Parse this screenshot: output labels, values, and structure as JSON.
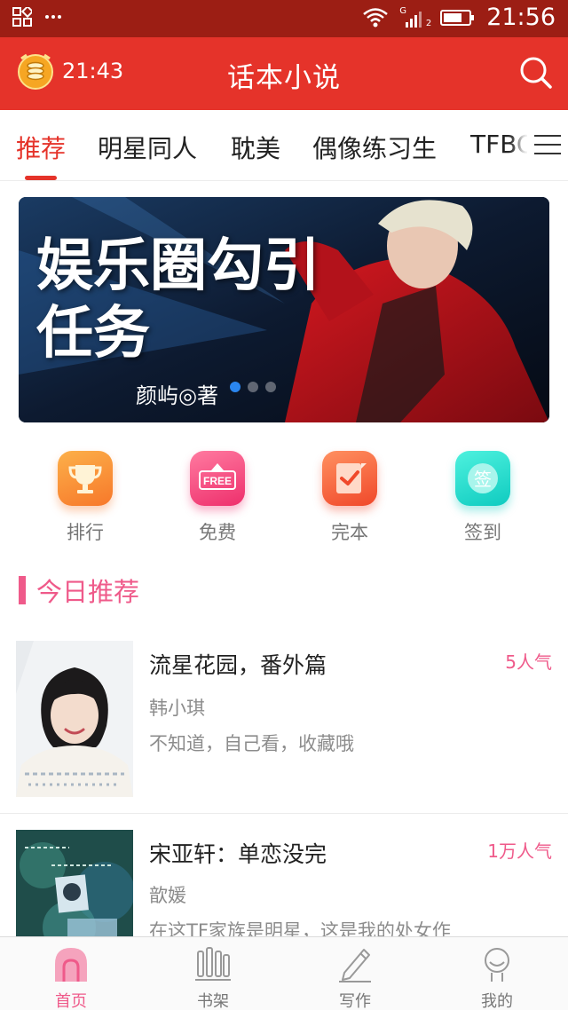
{
  "status_bar": {
    "time": "21:56",
    "left_icons": [
      "qr-icon",
      "more-dots-icon"
    ],
    "right_icons": [
      "wifi-icon",
      "signal-icon",
      "battery-icon"
    ],
    "signal_label": "G",
    "signal_sub": "2"
  },
  "header": {
    "timer_text": "21:43",
    "title": "话本小说",
    "timer_icon": "coin-stack-icon",
    "search_icon": "search-icon"
  },
  "tabs": {
    "items": [
      "推荐",
      "明星同人",
      "耽美",
      "偶像练习生",
      "TFBOYS"
    ],
    "active_index": 0,
    "menu_icon": "hamburger-menu-icon"
  },
  "banner": {
    "slide_count": 3,
    "active_slide": 0,
    "artwork_title": "娱乐圈勾引任务",
    "artwork_author": "颜屿◎著"
  },
  "quick_entries": [
    {
      "label": "排行",
      "icon": "trophy-icon",
      "color": "#f88a2c"
    },
    {
      "label": "免费",
      "icon": "free-tag-icon",
      "color": "#f2427a"
    },
    {
      "label": "完本",
      "icon": "check-note-icon",
      "color": "#f5623a"
    },
    {
      "label": "签到",
      "icon": "sign-in-icon",
      "color": "#1cd6c6"
    }
  ],
  "section": {
    "title": "今日推荐",
    "accent": "#ef5a8a"
  },
  "books": [
    {
      "title": "流星花园，番外篇",
      "author": "韩小琪",
      "desc": "不知道，自己看，收藏哦",
      "popularity": "5人气"
    },
    {
      "title": "宋亚轩：单恋没完",
      "author": "歆媛",
      "desc": "在这TF家族是明星，这是我的处女作",
      "popularity": "1万人气"
    }
  ],
  "bottom_nav": {
    "items": [
      {
        "label": "首页",
        "icon": "home-icon"
      },
      {
        "label": "书架",
        "icon": "bookshelf-icon"
      },
      {
        "label": "写作",
        "icon": "pen-icon"
      },
      {
        "label": "我的",
        "icon": "profile-icon"
      }
    ],
    "active_index": 0
  },
  "colors": {
    "primary_red": "#e5332a",
    "status_bar": "#9c1e14",
    "accent_pink": "#ef5a8a"
  }
}
